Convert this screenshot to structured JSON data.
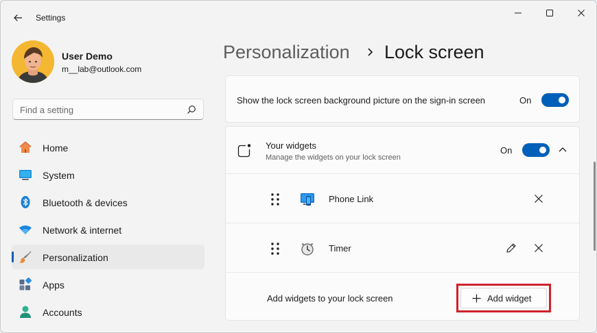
{
  "window": {
    "title": "Settings"
  },
  "account": {
    "name": "User Demo",
    "email": "m__lab@outlook.com"
  },
  "search": {
    "placeholder": "Find a setting",
    "value": ""
  },
  "nav": {
    "items": [
      {
        "label": "Home",
        "icon": "home-icon",
        "active": false
      },
      {
        "label": "System",
        "icon": "system-icon",
        "active": false
      },
      {
        "label": "Bluetooth & devices",
        "icon": "bluetooth-icon",
        "active": false
      },
      {
        "label": "Network & internet",
        "icon": "wifi-icon",
        "active": false
      },
      {
        "label": "Personalization",
        "icon": "brush-icon",
        "active": true
      },
      {
        "label": "Apps",
        "icon": "apps-icon",
        "active": false
      },
      {
        "label": "Accounts",
        "icon": "accounts-icon",
        "active": false
      }
    ]
  },
  "breadcrumb": {
    "parent": "Personalization",
    "separator": "›",
    "current": "Lock screen"
  },
  "settings": {
    "background_picture": {
      "label": "Show the lock screen background picture on the sign-in screen",
      "state": "On"
    },
    "widgets": {
      "title": "Your widgets",
      "subtitle": "Manage the widgets on your lock screen",
      "state": "On",
      "items": [
        {
          "label": "Phone Link",
          "icon": "phone-link-icon",
          "editable": false
        },
        {
          "label": "Timer",
          "icon": "timer-icon",
          "editable": true
        }
      ],
      "add_text": "Add widgets to your lock screen",
      "add_button": "Add widget"
    }
  },
  "colors": {
    "accent": "#005fb8",
    "highlight": "#d0212b"
  }
}
